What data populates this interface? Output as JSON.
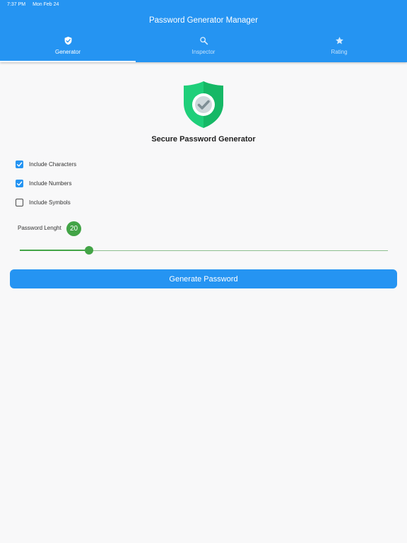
{
  "status_bar": {
    "time": "7:37 PM",
    "date": "Mon Feb 24"
  },
  "app_title": "Password Generator Manager",
  "tabs": [
    {
      "label": "Generator",
      "icon": "shield-check-icon",
      "active": true
    },
    {
      "label": "Inspector",
      "icon": "search-icon",
      "active": false
    },
    {
      "label": "Rating",
      "icon": "star-icon",
      "active": false
    }
  ],
  "heading": "Secure Password Generator",
  "options": [
    {
      "label": "Include Characters",
      "checked": true
    },
    {
      "label": "Include Numbers",
      "checked": true
    },
    {
      "label": "Include Symbols",
      "checked": false
    }
  ],
  "password_length": {
    "label": "Password Lenght",
    "value": "20",
    "slider_fraction": 0.188
  },
  "generate_button": {
    "label": "Generate Password"
  },
  "colors": {
    "primary": "#2594f2",
    "accent_green": "#43a447",
    "logo_green": "#1fcf7a",
    "background": "#f8f8f9"
  }
}
